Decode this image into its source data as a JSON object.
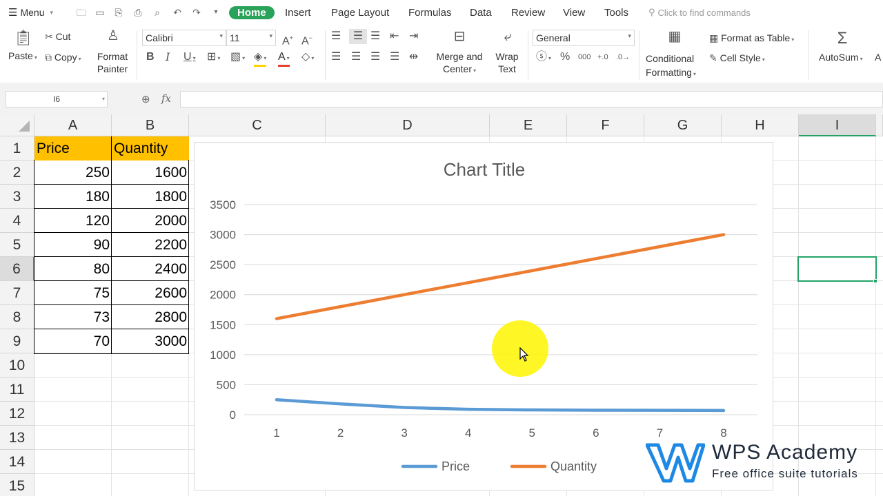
{
  "topbar": {
    "menu_label": "Menu",
    "tabs": [
      "Home",
      "Insert",
      "Page Layout",
      "Formulas",
      "Data",
      "Review",
      "View",
      "Tools"
    ],
    "search_placeholder": "Click to find commands"
  },
  "ribbon": {
    "paste": "Paste",
    "cut": "Cut",
    "copy": "Copy",
    "format_painter_1": "Format",
    "format_painter_2": "Painter",
    "font_name": "Calibri",
    "font_size": "11",
    "merge_1": "Merge and",
    "merge_2": "Center",
    "wrap_1": "Wrap",
    "wrap_2": "Text",
    "number_format": "General",
    "format_as_table": "Format as Table",
    "cell_style": "Cell Style",
    "cond_fmt_1": "Conditional",
    "cond_fmt_2": "Formatting",
    "autosum": "AutoSum",
    "autosum_next": "A"
  },
  "formula_bar": {
    "name_box": "I6",
    "fx": "fx",
    "formula": ""
  },
  "grid": {
    "columns": [
      "A",
      "B",
      "C",
      "D",
      "E",
      "F",
      "G",
      "H",
      "I"
    ],
    "selected_column": "I",
    "rows": [
      "1",
      "2",
      "3",
      "4",
      "5",
      "6",
      "7",
      "8",
      "9",
      "10",
      "11",
      "12",
      "13",
      "14",
      "15"
    ],
    "selected_row": "6",
    "header_row": [
      "Price",
      "Quantity"
    ],
    "data_rows": [
      [
        "250",
        "1600"
      ],
      [
        "180",
        "1800"
      ],
      [
        "120",
        "2000"
      ],
      [
        "90",
        "2200"
      ],
      [
        "80",
        "2400"
      ],
      [
        "75",
        "2600"
      ],
      [
        "73",
        "2800"
      ],
      [
        "70",
        "3000"
      ]
    ],
    "header_fill_color": "#ffc000",
    "selection_color": "#21a366"
  },
  "chart_data": {
    "type": "line",
    "title": "Chart Title",
    "x": [
      1,
      2,
      3,
      4,
      5,
      6,
      7,
      8
    ],
    "series": [
      {
        "name": "Price",
        "values": [
          250,
          180,
          120,
          90,
          80,
          75,
          73,
          70
        ],
        "color": "#5b9bd5"
      },
      {
        "name": "Quantity",
        "values": [
          1600,
          1800,
          2000,
          2200,
          2400,
          2600,
          2800,
          3000
        ],
        "color": "#ed7d31"
      }
    ],
    "yticks": [
      "0",
      "500",
      "1000",
      "1500",
      "2000",
      "2500",
      "3000",
      "3500"
    ],
    "ylim": [
      0,
      3500
    ],
    "grid": true,
    "legend": "bottom"
  },
  "watermark": {
    "title": "WPS Academy",
    "subtitle": "Free office suite tutorials",
    "color": "#1e88e5"
  }
}
